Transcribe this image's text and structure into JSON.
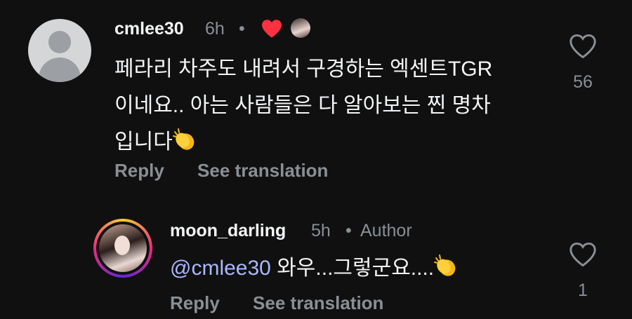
{
  "comments": [
    {
      "username": "cmlee30",
      "time": "6h",
      "separator": "•",
      "text_lines": [
        "페라리 차주도 내려서 구경하는 엑센트TGR",
        "이네요.. 아는 사람들은 다 알아보는 찐 명차",
        "입니다"
      ],
      "emoji": "clapping-hands",
      "liked_by_author_icon": "heart-icon",
      "reply_label": "Reply",
      "translate_label": "See translation",
      "like_count": "56"
    },
    {
      "username": "moon_darling",
      "time": "5h",
      "separator": "•",
      "badge": "Author",
      "mention": "@cmlee30",
      "text": " 와우...그렇군요....",
      "emoji": "clapping-hands",
      "reply_label": "Reply",
      "translate_label": "See translation",
      "like_count": "1"
    }
  ],
  "colors": {
    "background": "#101010",
    "primary_text": "#f3f5f7",
    "secondary_text": "#8a8f95",
    "mention": "#a9b8ff",
    "heart": "#ff3040"
  }
}
